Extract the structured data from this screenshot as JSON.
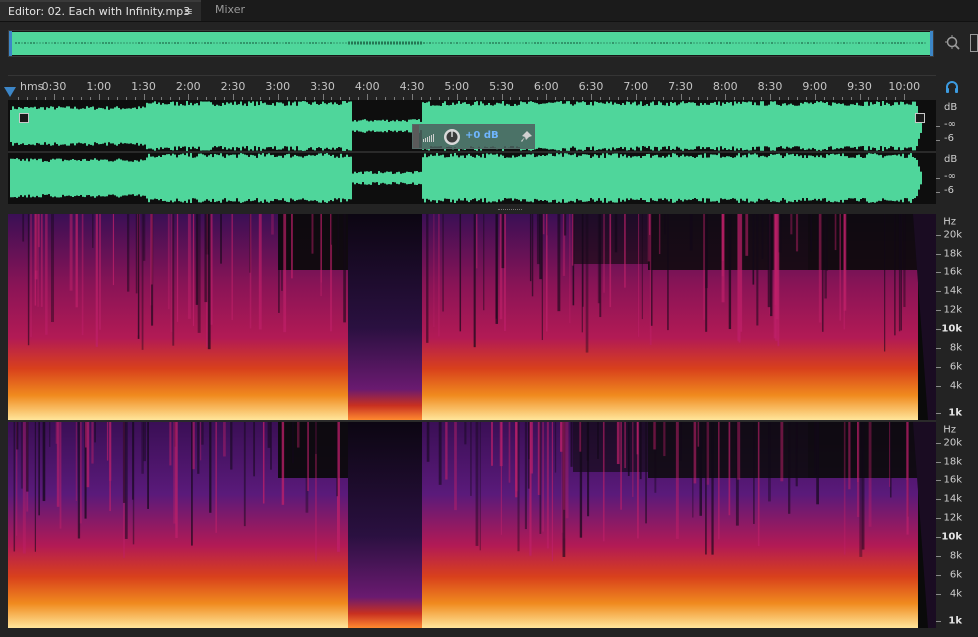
{
  "tabs": {
    "editor": {
      "label": "Editor: 02. Each with Infinity.mp3",
      "menu_glyph": "≡"
    },
    "mixer": {
      "label": "Mixer"
    }
  },
  "timeline": {
    "format": "hms",
    "labels": [
      "0:30",
      "1:00",
      "1:30",
      "2:00",
      "2:30",
      "3:00",
      "3:30",
      "4:00",
      "4:30",
      "5:00",
      "5:30",
      "6:00",
      "6:30",
      "7:00",
      "7:30",
      "8:00",
      "8:30",
      "9:00",
      "9:30",
      "10:00"
    ]
  },
  "waveform": {
    "color": "#4fd69b",
    "channel_1": {
      "db_unit": "dB",
      "db_labels": [
        "-∞",
        "-6"
      ]
    },
    "channel_2": {
      "db_unit": "dB",
      "db_labels": [
        "-∞",
        "-6"
      ]
    }
  },
  "hud": {
    "volume": "+0 dB"
  },
  "spectral": {
    "hz_unit": "Hz",
    "channel_1": {
      "hz_labels": [
        "20k",
        "18k",
        "16k",
        "14k",
        "12k",
        "10k",
        "8k",
        "6k",
        "4k",
        "1k"
      ]
    },
    "channel_2": {
      "hz_labels": [
        "20k",
        "18k",
        "16k",
        "14k",
        "12k",
        "10k",
        "8k",
        "6k",
        "4k",
        "1k"
      ]
    }
  },
  "icons": {
    "zoom": "zoom-magnifier-icon",
    "headphone": "headphone-monitor-icon",
    "fade_in": "fade-in-handle-icon",
    "fade_out": "fade-out-handle-icon",
    "pin": "pin-icon",
    "volume_knob": "volume-knob-icon"
  }
}
